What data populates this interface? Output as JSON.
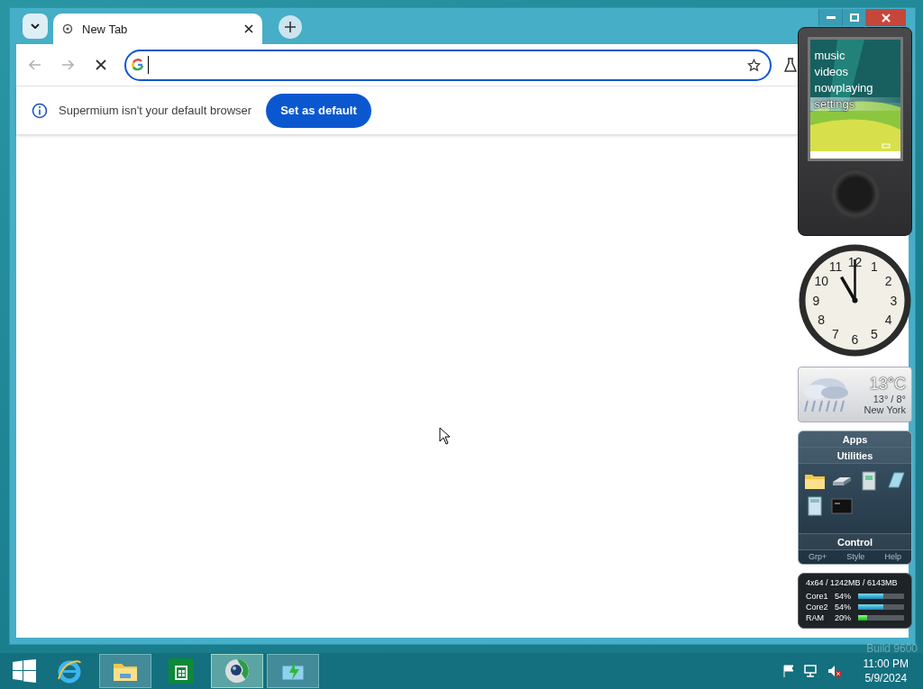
{
  "browser": {
    "tab": {
      "title": "New Tab",
      "selected": true
    },
    "infobar": {
      "message": "Supermium isn't your default browser",
      "button": "Set as default"
    }
  },
  "gadgets": {
    "media_player": {
      "menu": [
        {
          "label": "music",
          "selected": false
        },
        {
          "label": "videos",
          "selected": false
        },
        {
          "label": "nowplaying",
          "selected": false
        },
        {
          "label": "settings",
          "selected": true
        }
      ]
    },
    "clock": {
      "numerals": [
        "11",
        "12",
        "1",
        "10",
        "2",
        "9",
        "3",
        "8",
        "4",
        "7",
        "6",
        "5"
      ]
    },
    "weather": {
      "temperature": "13°C",
      "range": "13° / 8°",
      "city": "New York"
    },
    "launcher": {
      "title": "Apps",
      "group": "Utilities",
      "section": "Control",
      "buttons": [
        "Grp+",
        "Style",
        "Help"
      ]
    },
    "meter": {
      "summary": "4x64 / 1242MB / 6143MB",
      "rows": [
        {
          "label": "Core1",
          "reading": "54%",
          "level": 0.54,
          "kind": "cpu"
        },
        {
          "label": "Core2",
          "reading": "54%",
          "level": 0.54,
          "kind": "cpu"
        },
        {
          "label": "RAM",
          "reading": "20%",
          "level": 0.2,
          "kind": "ram"
        }
      ]
    }
  },
  "desktop": {
    "watermark": "Build 9600"
  },
  "taskbar": {
    "apps": [
      {
        "kind": "ie",
        "open": false,
        "selected": false
      },
      {
        "kind": "explorer",
        "open": true,
        "selected": false
      },
      {
        "kind": "store",
        "open": false,
        "selected": false
      },
      {
        "kind": "browser",
        "open": true,
        "selected": true
      },
      {
        "kind": "installer",
        "open": true,
        "selected": false
      }
    ],
    "time": "11:00 PM",
    "date": "5/9/2024"
  }
}
